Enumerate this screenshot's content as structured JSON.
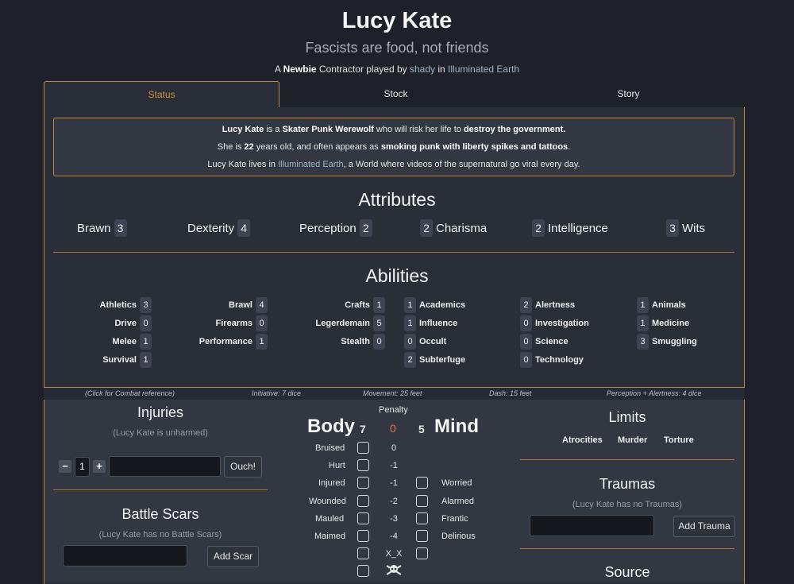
{
  "header": {
    "name": "Lucy Kate",
    "motto": "Fascists are food, not friends",
    "line": {
      "prefix": "A ",
      "rank": "Newbie",
      "role": " Contractor played by ",
      "player": "shady",
      "in": " in ",
      "world": "Illuminated Earth"
    }
  },
  "tabs": [
    {
      "label": "Status"
    },
    {
      "label": "Stock"
    },
    {
      "label": "Story"
    }
  ],
  "summary": {
    "l1": {
      "name": "Lucy Kate",
      "a": " is a ",
      "archetype": "Skater Punk Werewolf",
      "b": " who will risk her life to ",
      "ambition": "destroy the government."
    },
    "l2": {
      "a": "She is ",
      "age": "22",
      "b": " years old, and often appears as ",
      "look": "smoking punk with liberty spikes and tattoos",
      "c": "."
    },
    "l3": {
      "a": "Lucy Kate lives in ",
      "world": "Illuminated Earth",
      "b": ", a World where videos of the supernatural go viral every day."
    }
  },
  "attributes": {
    "title": "Attributes",
    "items": [
      {
        "label": "Brawn",
        "value": "3"
      },
      {
        "label": "Dexterity",
        "value": "4"
      },
      {
        "label": "Perception",
        "value": "2"
      },
      {
        "label": "Charisma",
        "value": "2"
      },
      {
        "label": "Intelligence",
        "value": "2"
      },
      {
        "label": "Wits",
        "value": "3"
      }
    ]
  },
  "abilities": {
    "title": "Abilities",
    "col1": [
      {
        "label": "Athletics",
        "value": "3"
      },
      {
        "label": "Drive",
        "value": "0"
      },
      {
        "label": "Melee",
        "value": "1"
      },
      {
        "label": "Survival",
        "value": "1"
      }
    ],
    "col2": [
      {
        "label": "Brawl",
        "value": "4"
      },
      {
        "label": "Firearms",
        "value": "0"
      },
      {
        "label": "Performance",
        "value": "1"
      }
    ],
    "col3": [
      {
        "label": "Crafts",
        "value": "1"
      },
      {
        "label": "Legerdemain",
        "value": "5"
      },
      {
        "label": "Stealth",
        "value": "0"
      }
    ],
    "col4": [
      {
        "label": "Academics",
        "value": "1"
      },
      {
        "label": "Influence",
        "value": "1"
      },
      {
        "label": "Occult",
        "value": "0"
      },
      {
        "label": "Subterfuge",
        "value": "2"
      }
    ],
    "col5": [
      {
        "label": "Alertness",
        "value": "2"
      },
      {
        "label": "Investigation",
        "value": "0"
      },
      {
        "label": "Science",
        "value": "0"
      },
      {
        "label": "Technology",
        "value": "0"
      }
    ],
    "col6": [
      {
        "label": "Animals",
        "value": "1"
      },
      {
        "label": "Medicine",
        "value": "1"
      },
      {
        "label": "Smuggling",
        "value": "3"
      }
    ]
  },
  "combat": {
    "reference": "(Click for Combat reference)",
    "initiative": "Initiative: 7 dice",
    "movement": "Movement: 25 feet",
    "dash": "Dash: 15 feet",
    "alertness": "Perception + Alertness: 4 dice"
  },
  "injuries": {
    "title": "Injuries",
    "status": "(Lucy Kate is unharmed)",
    "minus": "−",
    "plus": "+",
    "amount": "1",
    "ouch": "Ouch!"
  },
  "scars": {
    "title": "Battle Scars",
    "status": "(Lucy Kate has no Battle Scars)",
    "add": "Add Scar"
  },
  "health": {
    "penalty_label": "Penalty",
    "body_label": "Body",
    "body_value": "7",
    "penalty_value": "0",
    "mind_value": "5",
    "mind_label": "Mind",
    "penalty_color": "#e8734a",
    "body_levels": [
      "Bruised",
      "Hurt",
      "Injured",
      "Wounded",
      "Mauled",
      "Maimed"
    ],
    "penalties": [
      "0",
      "-1",
      "-1",
      "-2",
      "-3",
      "-4",
      "X_X"
    ],
    "mind_levels": [
      "Worried",
      "Alarmed",
      "Frantic",
      "Delirious"
    ]
  },
  "limits": {
    "title": "Limits",
    "items": [
      "Atrocities",
      "Murder",
      "Torture"
    ]
  },
  "traumas": {
    "title": "Traumas",
    "status": "(Lucy Kate has no Traumas)",
    "add": "Add Trauma"
  },
  "source": {
    "title": "Source"
  }
}
